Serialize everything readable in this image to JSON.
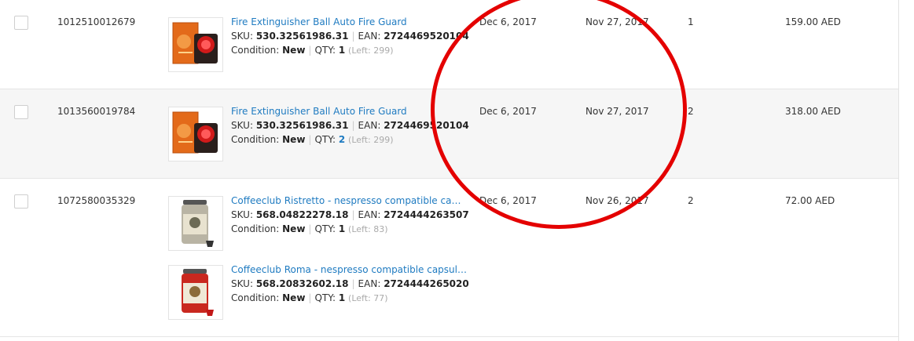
{
  "colors": {
    "link": "#1f7bc1",
    "annotation_circle": "#e40000",
    "row_alt_bg": "#f6f6f6"
  },
  "rows": [
    {
      "order_id": "1012510012679",
      "date_1": "Dec 6, 2017",
      "date_2": "Nov 27, 2017",
      "quantity": "1",
      "total": "159.00 AED",
      "items": [
        {
          "name": "Fire Extinguisher Ball Auto Fire Guard",
          "sku_label": "SKU:",
          "sku": "530.32561986.31",
          "ean_label": "EAN:",
          "ean": "2724469520104",
          "condition_label": "Condition:",
          "condition": "New",
          "qty_label": "QTY:",
          "qty": "1",
          "left": "(Left: 299)",
          "image": "fire-extinguisher-ball-image"
        }
      ]
    },
    {
      "order_id": "1013560019784",
      "date_1": "Dec 6, 2017",
      "date_2": "Nov 27, 2017",
      "quantity": "2",
      "total": "318.00 AED",
      "items": [
        {
          "name": "Fire Extinguisher Ball Auto Fire Guard",
          "sku_label": "SKU:",
          "sku": "530.32561986.31",
          "ean_label": "EAN:",
          "ean": "2724469520104",
          "condition_label": "Condition:",
          "condition": "New",
          "qty_label": "QTY:",
          "qty": "2",
          "left": "(Left: 299)",
          "image": "fire-extinguisher-ball-image"
        }
      ]
    },
    {
      "order_id": "1072580035329",
      "date_1": "Dec 6, 2017",
      "date_2": "Nov 26, 2017",
      "quantity": "2",
      "total": "72.00 AED",
      "items": [
        {
          "name": "Coffeeclub Ristretto - nespresso compatible capsules",
          "sku_label": "SKU:",
          "sku": "568.04822278.18",
          "ean_label": "EAN:",
          "ean": "2724444263507",
          "condition_label": "Condition:",
          "condition": "New",
          "qty_label": "QTY:",
          "qty": "1",
          "left": "(Left: 83)",
          "image": "coffee-capsule-jar-image"
        },
        {
          "name": "Coffeeclub Roma - nespresso compatible capsules c...",
          "sku_label": "SKU:",
          "sku": "568.20832602.18",
          "ean_label": "EAN:",
          "ean": "2724444265020",
          "condition_label": "Condition:",
          "condition": "New",
          "qty_label": "QTY:",
          "qty": "1",
          "left": "(Left: 77)",
          "image": "coffee-capsule-jar-red-image"
        }
      ]
    }
  ]
}
